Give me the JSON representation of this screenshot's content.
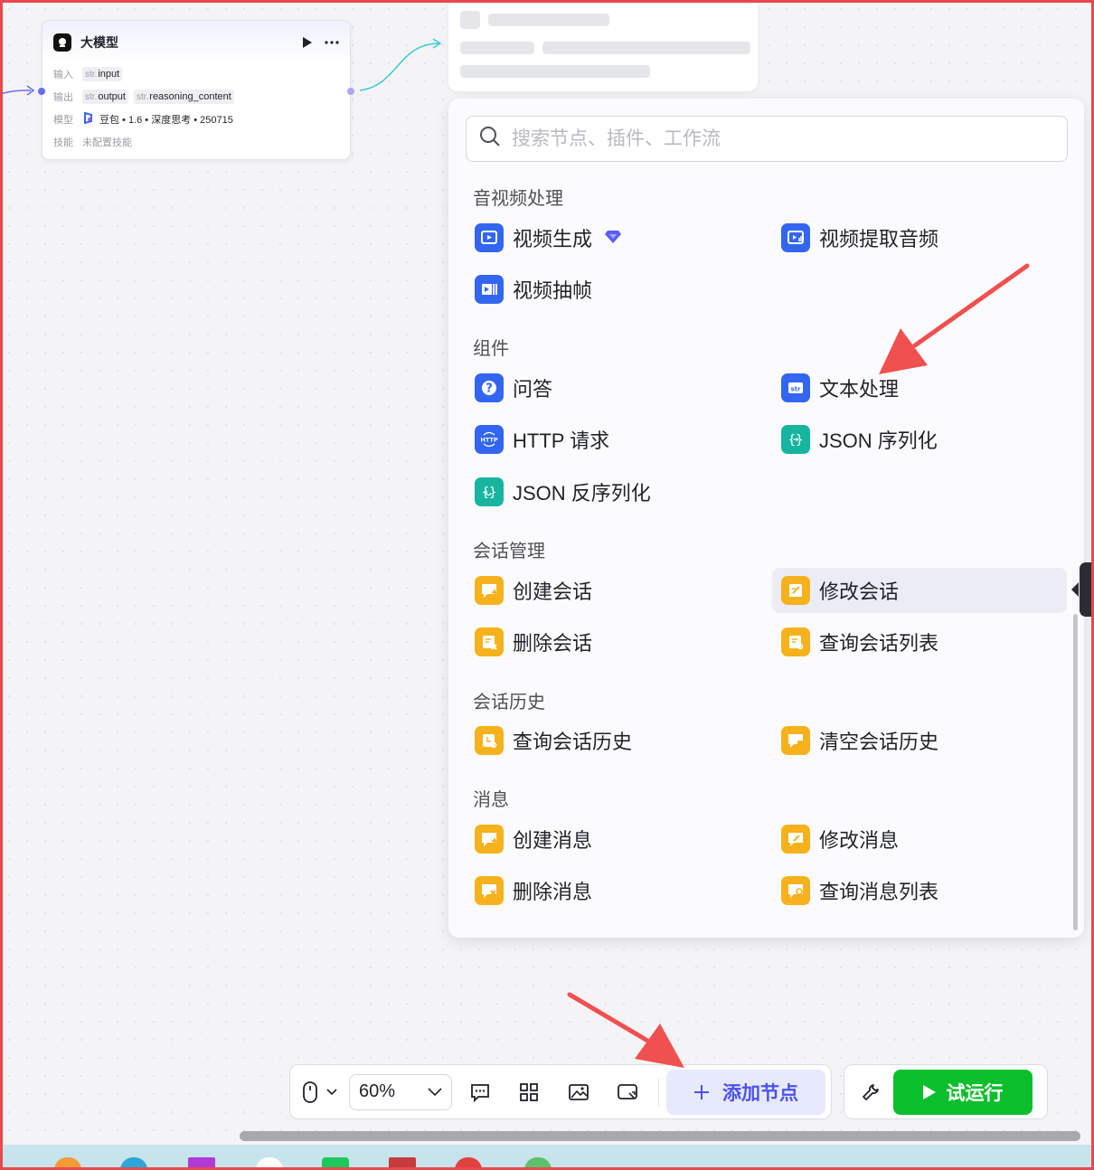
{
  "node": {
    "title": "大模型",
    "input_label": "输入",
    "output_label": "输出",
    "model_label": "模型",
    "skill_label": "技能",
    "type_prefix": "str.",
    "inputs": [
      "input"
    ],
    "outputs": [
      "output",
      "reasoning_content"
    ],
    "model_value": "豆包 • 1.6 • 深度思考 • 250715",
    "skill_value": "未配置技能"
  },
  "panel": {
    "search_placeholder": "搜索节点、插件、工作流",
    "sections": [
      {
        "title": "音视频处理",
        "items": [
          "视频生成",
          "视频提取音频",
          "视频抽帧"
        ]
      },
      {
        "title": "组件",
        "items": [
          "问答",
          "文本处理",
          "HTTP 请求",
          "JSON 序列化",
          "JSON 反序列化"
        ]
      },
      {
        "title": "会话管理",
        "items": [
          "创建会话",
          "修改会话",
          "删除会话",
          "查询会话列表"
        ]
      },
      {
        "title": "会话历史",
        "items": [
          "查询会话历史",
          "清空会话历史"
        ]
      },
      {
        "title": "消息",
        "items": [
          "创建消息",
          "修改消息",
          "删除消息",
          "查询消息列表"
        ]
      }
    ]
  },
  "toolbar": {
    "zoom": "60%",
    "add_node": "添加节点",
    "run": "试运行"
  },
  "colors": {
    "accent": "#4d53e8",
    "run_green": "#0bbf2c",
    "icon_blue": "#3366f0",
    "icon_teal": "#17b5a0",
    "icon_amber": "#f5b21d",
    "annotation_red": "#e8484b"
  }
}
